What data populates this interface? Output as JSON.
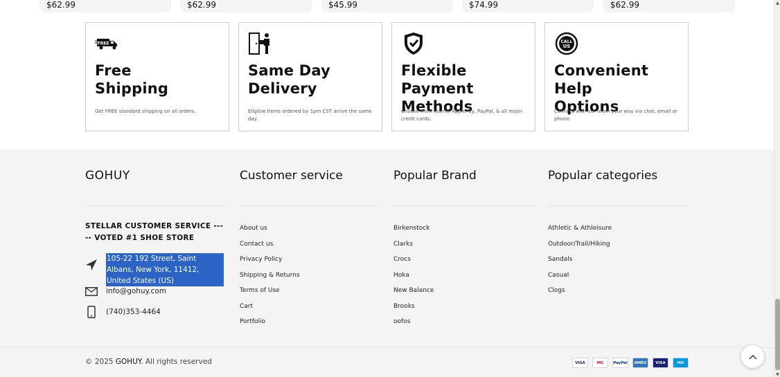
{
  "products": [
    {
      "price": "$62.99"
    },
    {
      "price": "$62.99"
    },
    {
      "price": "$45.99"
    },
    {
      "price": "$74.99"
    },
    {
      "price": "$62.99"
    }
  ],
  "features": [
    {
      "icon": "free-delivery-truck-icon",
      "title_line1": "Free",
      "title_line2": "Shipping",
      "desc": "Get FREE standard shipping on all orders."
    },
    {
      "icon": "door-delivery-person-icon",
      "title_line1": "Same Day",
      "title_line2": "Delivery",
      "desc": "Eligible items ordered by 1pm CST arrive the same day."
    },
    {
      "icon": "shield-check-icon",
      "title_line1": "Flexible Payment",
      "title_line2": "Methods",
      "desc": "Choose from Klarna, ApplePay, PayPal, & all major credit cards."
    },
    {
      "icon": "call-us-icon",
      "title_line1": "Convenient Help",
      "title_line2": "Options",
      "desc": "Connect with our team your way via chat, email or phone."
    }
  ],
  "footer": {
    "brand": "GOHUY",
    "tagline": "STELLAR CUSTOMER SERVICE ----- VOTED #1 SHOE STORE",
    "address": "105-22 192 Street, Saint Albans, New York, 11412, United States (US)",
    "email": "info@gohuy.com",
    "phone": "(740)353-4464",
    "customer_service": {
      "title": "Customer service",
      "links": [
        "About us",
        "Contact us",
        "Privacy Policy",
        "Shipping & Returns",
        "Terms of Use",
        "Cart",
        "Portfolio"
      ]
    },
    "popular_brand": {
      "title": "Popular Brand",
      "links": [
        "Birkenstock",
        "Clarks",
        "Crocs",
        "Hoka",
        "New Balance",
        "Brooks",
        "oofos"
      ]
    },
    "popular_categories": {
      "title": "Popular categories",
      "links": [
        "Athletic & Athleisure",
        "Outdoor/Trail/Hiking",
        "Sandals",
        "Casual",
        "Clogs"
      ]
    },
    "copyright_prefix": "© 2025",
    "copyright_brand": "GOHUY",
    "copyright_suffix": ". All rights reserved",
    "payments": [
      {
        "name": "visa-icon",
        "label": "VISA",
        "bg": "#ffffff",
        "fg": "#1a1f71"
      },
      {
        "name": "mastercard-icon",
        "label": "MC",
        "bg": "#ffffff",
        "fg": "#eb001b"
      },
      {
        "name": "paypal-icon",
        "label": "PayPal",
        "bg": "#ffffff",
        "fg": "#003087"
      },
      {
        "name": "amex-icon",
        "label": "AMEX",
        "bg": "#2e77bc",
        "fg": "#ffffff"
      },
      {
        "name": "visa-electron-icon",
        "label": "VISA",
        "bg": "#1a1f71",
        "fg": "#ffffff"
      },
      {
        "name": "maestro-icon",
        "label": "MA",
        "bg": "#0099df",
        "fg": "#ffffff"
      }
    ]
  },
  "colors": {
    "accent": "#2b63c6",
    "footer_bg": "#f4f4f4"
  }
}
